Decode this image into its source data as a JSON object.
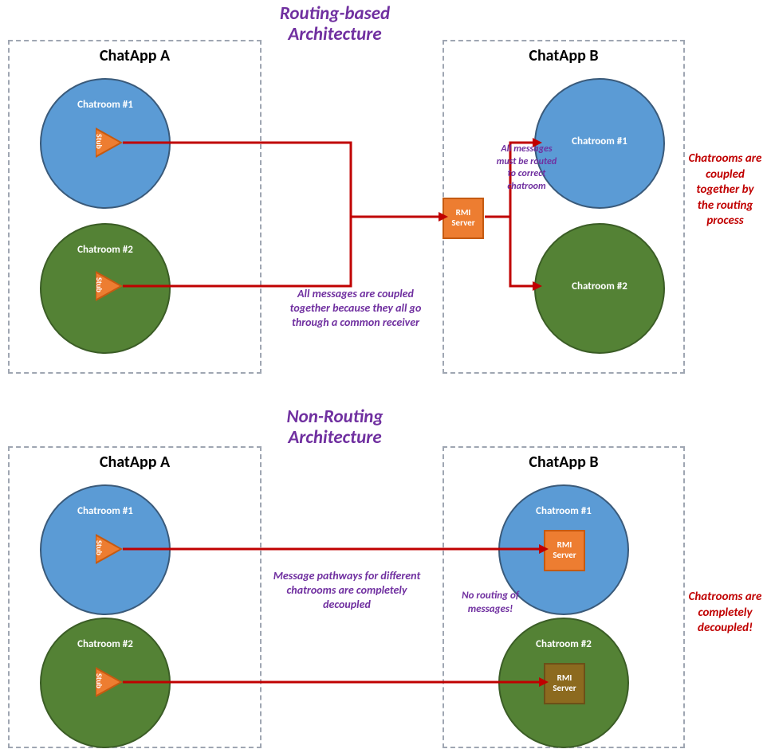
{
  "diagram1": {
    "title": "Routing-based Architecture",
    "appA": {
      "label": "ChatApp A",
      "room1": "Chatroom #1",
      "room2": "Chatroom #2",
      "stub": "Stub"
    },
    "appB": {
      "label": "ChatApp B",
      "room1": "Chatroom #1",
      "room2": "Chatroom #2"
    },
    "rmi": "RMI Server",
    "note_center": "All messages are coupled together because they all go through a common receiver",
    "note_routing": "All messages must be routed to correct chatroom",
    "note_right": "Chatrooms are coupled together by the routing process"
  },
  "diagram2": {
    "title": "Non-Routing Architecture",
    "appA": {
      "label": "ChatApp A",
      "room1": "Chatroom #1",
      "room2": "Chatroom #2",
      "stub": "Stub"
    },
    "appB": {
      "label": "ChatApp B",
      "room1": "Chatroom #1",
      "room2": "Chatroom #2"
    },
    "rmi": "RMI Server",
    "note_center": "Message pathways for different chatrooms are completely decoupled",
    "note_norouting": "No routing of messages!",
    "note_right": "Chatrooms are completely decoupled!"
  }
}
